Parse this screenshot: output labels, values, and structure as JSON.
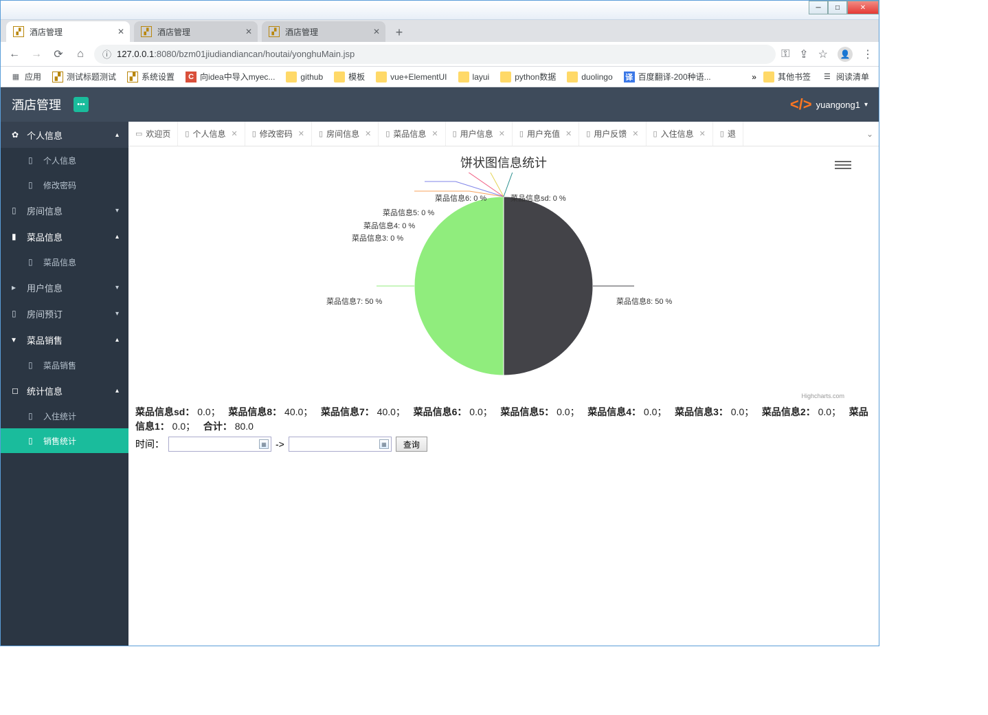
{
  "browser": {
    "tabs": [
      {
        "title": "酒店管理",
        "active": true
      },
      {
        "title": "酒店管理",
        "active": false
      },
      {
        "title": "酒店管理",
        "active": false
      }
    ],
    "url_prefix": "127.0.0.1",
    "url_rest": ":8080/bzm01jiudiandiancan/houtai/yonghuMain.jsp",
    "bookmarks": {
      "apps": "应用",
      "items": [
        "测试标题测试",
        "系统设置",
        "向idea中导入myec...",
        "github",
        "模板",
        "vue+ElementUI",
        "layui",
        "python数据",
        "duolingo",
        "百度翻译-200种语..."
      ],
      "more": "»",
      "other": "其他书签",
      "reading": "阅读清单"
    }
  },
  "header": {
    "title": "酒店管理",
    "user": "yuangong1"
  },
  "sidebar": {
    "personal": {
      "label": "个人信息",
      "sub": [
        "个人信息",
        "修改密码"
      ]
    },
    "room": {
      "label": "房间信息"
    },
    "dish": {
      "label": "菜品信息",
      "sub": [
        "菜品信息"
      ]
    },
    "user": {
      "label": "用户信息"
    },
    "booking": {
      "label": "房间预订"
    },
    "sales": {
      "label": "菜品销售",
      "sub": [
        "菜品销售"
      ]
    },
    "stats": {
      "label": "统计信息",
      "sub": [
        "入住统计",
        "销售统计"
      ]
    }
  },
  "content_tabs": [
    "欢迎页",
    "个人信息",
    "修改密码",
    "房间信息",
    "菜品信息",
    "用户信息",
    "用户充值",
    "用户反馈",
    "入住信息",
    "退"
  ],
  "chart_data": {
    "type": "pie",
    "title": "饼状图信息统计",
    "series": [
      {
        "name": "菜品信息8",
        "value": 50.0,
        "color": "#434348"
      },
      {
        "name": "菜品信息7",
        "value": 50.0,
        "color": "#90ed7d"
      },
      {
        "name": "菜品信息3",
        "value": 0.0,
        "color": "#f7a35c"
      },
      {
        "name": "菜品信息4",
        "value": 0.0,
        "color": "#8085e9"
      },
      {
        "name": "菜品信息5",
        "value": 0.0,
        "color": "#f15c80"
      },
      {
        "name": "菜品信息6",
        "value": 0.0,
        "color": "#e4d354"
      },
      {
        "name": "菜品信息sd",
        "value": 0.0,
        "color": "#2b908f"
      }
    ],
    "credit": "Highcharts.com"
  },
  "summary": {
    "items": [
      {
        "k": "菜品信息sd：",
        "v": "0.0；"
      },
      {
        "k": "菜品信息8：",
        "v": "40.0；"
      },
      {
        "k": "菜品信息7：",
        "v": "40.0；"
      },
      {
        "k": "菜品信息6：",
        "v": "0.0；"
      },
      {
        "k": "菜品信息5：",
        "v": "0.0；"
      },
      {
        "k": "菜品信息4：",
        "v": "0.0；"
      },
      {
        "k": "菜品信息3：",
        "v": "0.0；"
      },
      {
        "k": "菜品信息2：",
        "v": "0.0；"
      },
      {
        "k": "菜品信息1：",
        "v": "0.0；"
      },
      {
        "k": "合计：",
        "v": "80.0"
      }
    ]
  },
  "query": {
    "label": "时间：",
    "sep": "->",
    "btn": "查询"
  }
}
